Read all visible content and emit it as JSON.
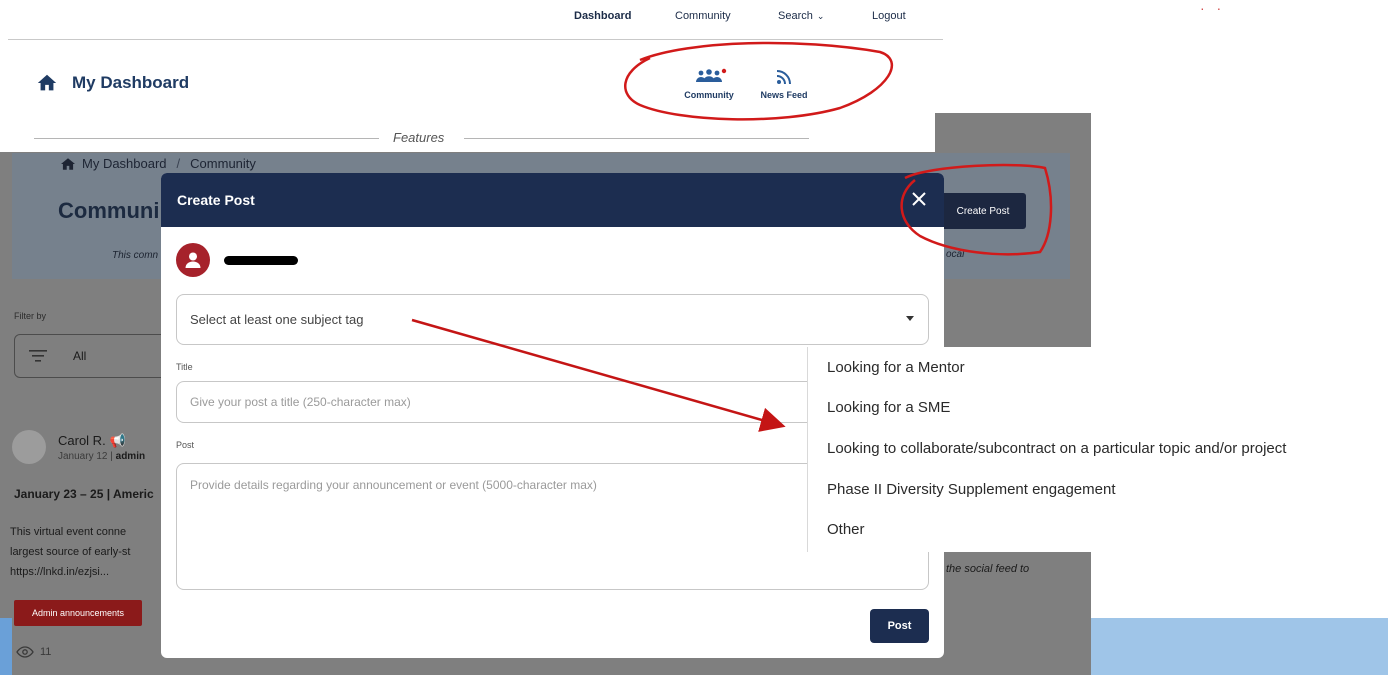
{
  "topnav": {
    "dashboard": "Dashboard",
    "community": "Community",
    "search": "Search",
    "logout": "Logout"
  },
  "header": {
    "title": "My Dashboard",
    "features": [
      {
        "label": "Community",
        "icon": "community-icon"
      },
      {
        "label": "News Feed",
        "icon": "rss-icon"
      }
    ],
    "features_divider": "Features"
  },
  "background_page": {
    "breadcrumb": [
      "My Dashboard",
      "Community"
    ],
    "title": "Communi",
    "description": "This comn",
    "description_tail": "ocal",
    "create_post": "Create Post",
    "filter_label": "Filter by",
    "filter_value": "All",
    "post": {
      "author": "Carol R.",
      "date": "January 12",
      "role": "admin",
      "heading": "January 23 – 25 | Americ",
      "body": [
        "This virtual event conne",
        "largest source of early-st",
        "https://lnkd.in/ezjsi..."
      ],
      "badge": "Admin announcements",
      "views": "11"
    },
    "feed_tail": "the social feed to"
  },
  "modal": {
    "title": "Create Post",
    "tag_placeholder": "Select at least one subject tag",
    "title_label": "Title",
    "title_placeholder": "Give your post a title (250-character max)",
    "post_label": "Post",
    "post_placeholder": "Provide details regarding your announcement or event (5000-character max)",
    "submit": "Post"
  },
  "tag_options": [
    "Looking for a Mentor",
    "Looking for a SME",
    "Looking to collaborate/subcontract on a particular topic and/or project",
    "Phase II Diversity Supplement engagement",
    "Other"
  ],
  "colors": {
    "navy": "#1c2d50",
    "brand_red": "#a6222b",
    "annotation_red": "#d11a1a"
  }
}
